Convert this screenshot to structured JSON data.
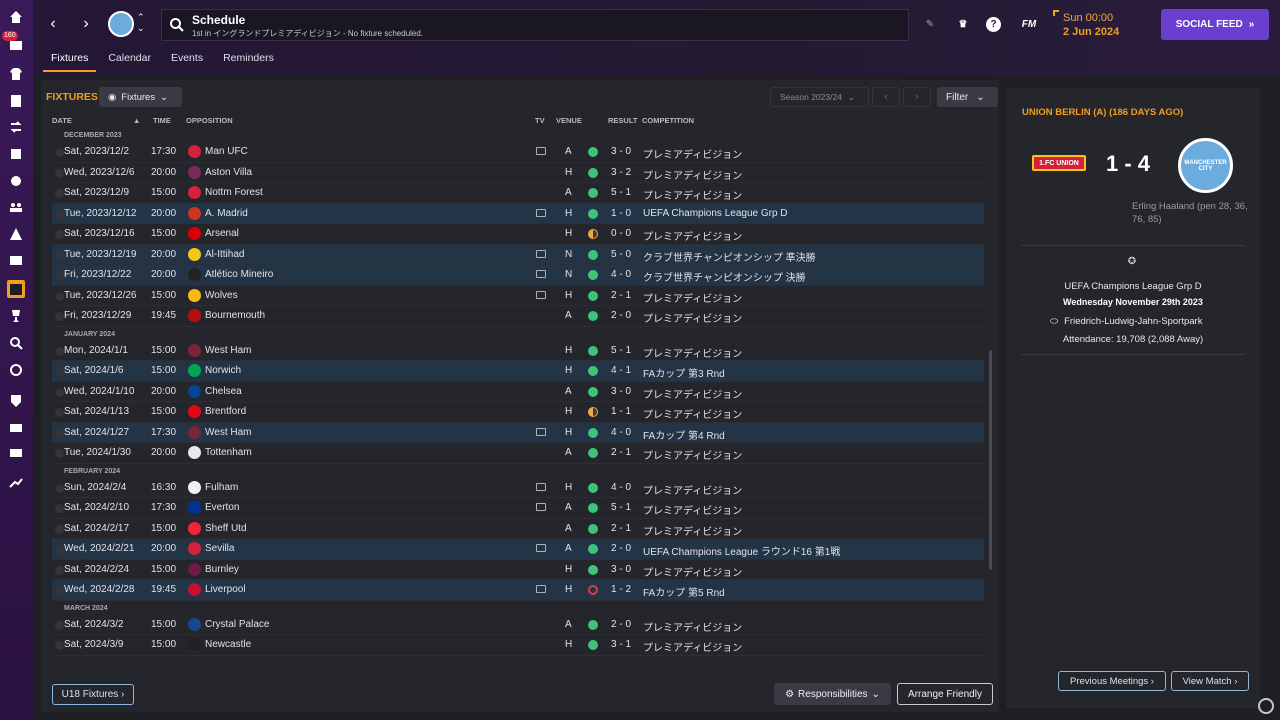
{
  "nav": {
    "badge": "160"
  },
  "header": {
    "title": "Schedule",
    "subtitle": "1st in イングランドプレミアディビジョン - No fixture scheduled.",
    "fm": "FM",
    "time": "Sun 00:00",
    "date": "2 Jun 2024",
    "social_feed": "SOCIAL FEED"
  },
  "tabs": [
    "Fixtures",
    "Calendar",
    "Events",
    "Reminders"
  ],
  "toolbar": {
    "title": "FIXTURES",
    "view": "Fixtures",
    "season": "Season 2023/24",
    "filter": "Filter"
  },
  "columns": {
    "date": "DATE",
    "time": "TIME",
    "opposition": "OPPOSITION",
    "tv": "TV",
    "venue": "VENUE",
    "result": "RESULT",
    "competition": "COMPETITION"
  },
  "months": [
    "DECEMBER 2023",
    "JANUARY 2024",
    "FEBRUARY 2024",
    "MARCH 2024"
  ],
  "fixtures": [
    {
      "date": "Sat, 2023/12/2",
      "time": "17:30",
      "opp": "Man UFC",
      "tv": true,
      "venue": "A",
      "res": "w",
      "score": "3 - 0",
      "comp": "プレミアディビジョン",
      "eu": false,
      "crest": "#d4213c",
      "month": 0
    },
    {
      "date": "Wed, 2023/12/6",
      "time": "20:00",
      "opp": "Aston Villa",
      "tv": false,
      "venue": "H",
      "res": "w",
      "score": "3 - 2",
      "comp": "プレミアディビジョン",
      "eu": false,
      "crest": "#7a2a5a",
      "month": 0
    },
    {
      "date": "Sat, 2023/12/9",
      "time": "15:00",
      "opp": "Nottm Forest",
      "tv": false,
      "venue": "A",
      "res": "w",
      "score": "5 - 1",
      "comp": "プレミアディビジョン",
      "eu": false,
      "crest": "#d4213c",
      "month": 0
    },
    {
      "date": "Tue, 2023/12/12",
      "time": "20:00",
      "opp": "A. Madrid",
      "tv": true,
      "venue": "H",
      "res": "w",
      "score": "1 - 0",
      "comp": "UEFA Champions League Grp D",
      "eu": true,
      "crest": "#cb3524",
      "month": 0
    },
    {
      "date": "Sat, 2023/12/16",
      "time": "15:00",
      "opp": "Arsenal",
      "tv": false,
      "venue": "H",
      "res": "d",
      "score": "0 - 0",
      "comp": "プレミアディビジョン",
      "eu": false,
      "crest": "#db0007",
      "month": 0
    },
    {
      "date": "Tue, 2023/12/19",
      "time": "20:00",
      "opp": "Al-Ittihad",
      "tv": true,
      "venue": "N",
      "res": "w",
      "score": "5 - 0",
      "comp": "クラブ世界チャンピオンシップ 準決勝",
      "eu": true,
      "crest": "#f5c518",
      "month": 0
    },
    {
      "date": "Fri, 2023/12/22",
      "time": "20:00",
      "opp": "Atlético Mineiro",
      "tv": true,
      "venue": "N",
      "res": "w",
      "score": "4 - 0",
      "comp": "クラブ世界チャンピオンシップ 決勝",
      "eu": true,
      "crest": "#222222",
      "month": 0
    },
    {
      "date": "Tue, 2023/12/26",
      "time": "15:00",
      "opp": "Wolves",
      "tv": true,
      "venue": "H",
      "res": "w",
      "score": "2 - 1",
      "comp": "プレミアディビジョン",
      "eu": false,
      "crest": "#fdb913",
      "month": 0
    },
    {
      "date": "Fri, 2023/12/29",
      "time": "19:45",
      "opp": "Bournemouth",
      "tv": false,
      "venue": "A",
      "res": "w",
      "score": "2 - 0",
      "comp": "プレミアディビジョン",
      "eu": false,
      "crest": "#b50e12",
      "month": 0
    },
    {
      "date": "Mon, 2024/1/1",
      "time": "15:00",
      "opp": "West Ham",
      "tv": false,
      "venue": "H",
      "res": "w",
      "score": "5 - 1",
      "comp": "プレミアディビジョン",
      "eu": false,
      "crest": "#7a263a",
      "month": 1
    },
    {
      "date": "Sat, 2024/1/6",
      "time": "15:00",
      "opp": "Norwich",
      "tv": false,
      "venue": "H",
      "res": "w",
      "score": "4 - 1",
      "comp": "FAカップ 第3 Rnd",
      "eu": true,
      "crest": "#00a650",
      "month": 1
    },
    {
      "date": "Wed, 2024/1/10",
      "time": "20:00",
      "opp": "Chelsea",
      "tv": false,
      "venue": "A",
      "res": "w",
      "score": "3 - 0",
      "comp": "プレミアディビジョン",
      "eu": false,
      "crest": "#034694",
      "month": 1
    },
    {
      "date": "Sat, 2024/1/13",
      "time": "15:00",
      "opp": "Brentford",
      "tv": false,
      "venue": "H",
      "res": "d",
      "score": "1 - 1",
      "comp": "プレミアディビジョン",
      "eu": false,
      "crest": "#e30613",
      "month": 1
    },
    {
      "date": "Sat, 2024/1/27",
      "time": "17:30",
      "opp": "West Ham",
      "tv": true,
      "venue": "H",
      "res": "w",
      "score": "4 - 0",
      "comp": "FAカップ 第4 Rnd",
      "eu": true,
      "crest": "#7a263a",
      "month": 1
    },
    {
      "date": "Tue, 2024/1/30",
      "time": "20:00",
      "opp": "Tottenham",
      "tv": false,
      "venue": "A",
      "res": "w",
      "score": "2 - 1",
      "comp": "プレミアディビジョン",
      "eu": false,
      "crest": "#e8e8ee",
      "month": 1
    },
    {
      "date": "Sun, 2024/2/4",
      "time": "16:30",
      "opp": "Fulham",
      "tv": true,
      "venue": "H",
      "res": "w",
      "score": "4 - 0",
      "comp": "プレミアディビジョン",
      "eu": false,
      "crest": "#f0f0f0",
      "month": 2
    },
    {
      "date": "Sat, 2024/2/10",
      "time": "17:30",
      "opp": "Everton",
      "tv": true,
      "venue": "A",
      "res": "w",
      "score": "5 - 1",
      "comp": "プレミアディビジョン",
      "eu": false,
      "crest": "#003399",
      "month": 2
    },
    {
      "date": "Sat, 2024/2/17",
      "time": "15:00",
      "opp": "Sheff Utd",
      "tv": false,
      "venue": "A",
      "res": "w",
      "score": "2 - 1",
      "comp": "プレミアディビジョン",
      "eu": false,
      "crest": "#ee2737",
      "month": 2
    },
    {
      "date": "Wed, 2024/2/21",
      "time": "20:00",
      "opp": "Sevilla",
      "tv": true,
      "venue": "A",
      "res": "w",
      "score": "2 - 0",
      "comp": "UEFA Champions League ラウンド16 第1戦",
      "eu": true,
      "crest": "#d4213c",
      "month": 2
    },
    {
      "date": "Sat, 2024/2/24",
      "time": "15:00",
      "opp": "Burnley",
      "tv": false,
      "venue": "H",
      "res": "w",
      "score": "3 - 0",
      "comp": "プレミアディビジョン",
      "eu": false,
      "crest": "#6c1d45",
      "month": 2
    },
    {
      "date": "Wed, 2024/2/28",
      "time": "19:45",
      "opp": "Liverpool",
      "tv": true,
      "venue": "H",
      "res": "l",
      "score": "1 - 2",
      "comp": "FAカップ 第5 Rnd",
      "eu": true,
      "crest": "#c8102e",
      "month": 2
    },
    {
      "date": "Sat, 2024/3/2",
      "time": "15:00",
      "opp": "Crystal Palace",
      "tv": false,
      "venue": "A",
      "res": "w",
      "score": "2 - 0",
      "comp": "プレミアディビジョン",
      "eu": false,
      "crest": "#1b458f",
      "month": 3
    },
    {
      "date": "Sat, 2024/3/9",
      "time": "15:00",
      "opp": "Newcastle",
      "tv": false,
      "venue": "H",
      "res": "w",
      "score": "3 - 1",
      "comp": "プレミアディビジョン",
      "eu": false,
      "crest": "#241f20",
      "month": 3
    }
  ],
  "bottom": {
    "u18": "U18 Fixtures",
    "responsibilities": "Responsibilities",
    "arrange": "Arrange Friendly"
  },
  "side": {
    "title": "UNION BERLIN (A) (186 DAYS AGO)",
    "home_crest": "1.FC UNION",
    "score": "1 - 4",
    "away_crest": "MANCHESTER CITY",
    "scorers": "Erling Haaland (pen 28, 36, 76, 85)",
    "competition": "UEFA Champions League Grp D",
    "date": "Wednesday November 29th 2023",
    "stadium": "Friedrich-Ludwig-Jahn-Sportpark",
    "attendance": "Attendance: 19,708 (2,088 Away)",
    "prev_meetings": "Previous Meetings",
    "view_match": "View Match"
  }
}
